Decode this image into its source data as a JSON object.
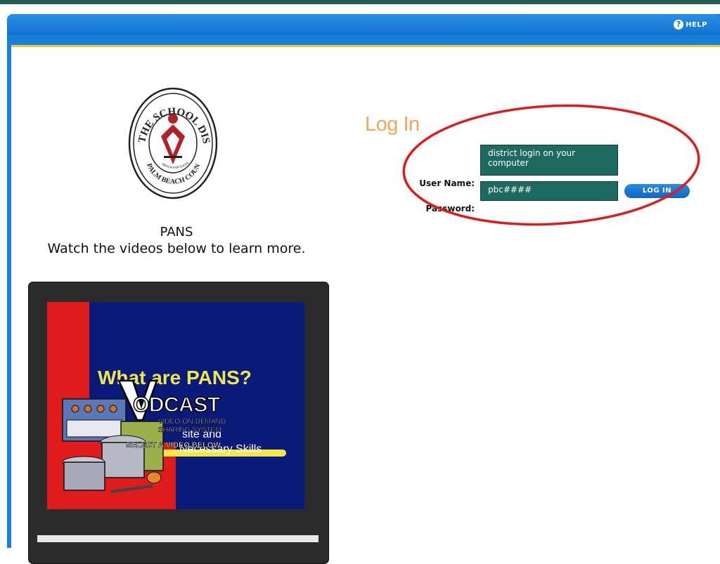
{
  "header": {
    "help_label": "HELP",
    "help_icon": "question-circle-icon"
  },
  "logo": {
    "top_text": "THE SCHOOL DISTRICT",
    "bottom_text": "PALM BEACH COUNTY",
    "motto": "REACH FOR EXCELLENCE",
    "colors": {
      "emblem": "#b32025",
      "ring": "#222222"
    }
  },
  "intro": {
    "title": "PANS",
    "subtitle": "Watch the videos below to learn more."
  },
  "video": {
    "heading": "What are PANS?",
    "line1": "site and",
    "line2": "Necessary Skills",
    "overlay_brand": "ODCAST",
    "overlay_sub1": "VIDEO-ON-DEMAND",
    "overlay_sub2": "SHARING SYSTEM",
    "overlay_prompt": "SELECT A VIDEO BELOW",
    "colors": {
      "left_panel": "#e01b1b",
      "right_panel": "#0a1a7a",
      "heading": "#f2e64a"
    }
  },
  "login": {
    "title": "Log In",
    "username_label": "User Name:",
    "username_value": "district login on your computer",
    "password_label": "Password:",
    "password_value": "pbc####",
    "button_label": "LOG IN",
    "annotation_color": "#e01b1b"
  }
}
